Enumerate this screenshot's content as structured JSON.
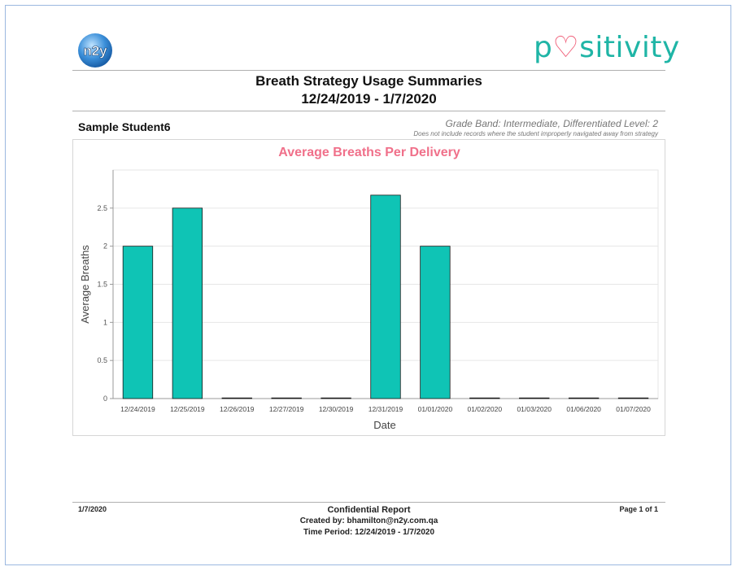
{
  "header": {
    "n2y_logo_text": "n2y",
    "brand_logo": {
      "pre": "p",
      "heart_glyph": "♡",
      "post": "sitivity"
    },
    "title": "Breath Strategy Usage Summaries",
    "date_range": "12/24/2019 - 1/7/2020"
  },
  "student": {
    "name": "Sample Student6",
    "grade_info": "Grade Band: Intermediate, Differentiated Level: 2",
    "note": "Does not include records where the student improperly navigated away from strategy"
  },
  "chart_data": {
    "type": "bar",
    "title": "Average Breaths Per Delivery",
    "xlabel": "Date",
    "ylabel": "Average Breaths",
    "categories": [
      "12/24/2019",
      "12/25/2019",
      "12/26/2019",
      "12/27/2019",
      "12/30/2019",
      "12/31/2019",
      "01/01/2020",
      "01/02/2020",
      "01/03/2020",
      "01/06/2020",
      "01/07/2020"
    ],
    "values": [
      2,
      2.5,
      0,
      0,
      0,
      2.67,
      2,
      0,
      0,
      0,
      0
    ],
    "ylim": [
      0,
      3
    ],
    "yticks": [
      "0",
      "0.5",
      "1",
      "1.5",
      "2",
      "2.5"
    ],
    "grid": true,
    "colors": {
      "bar": "#0fc4b5",
      "bar_stroke": "#1a1a1a",
      "title": "#f0708a"
    }
  },
  "footer": {
    "date": "1/7/2020",
    "page": "Page 1 of 1",
    "confidential": "Confidential Report",
    "created_by": "Created by: bhamilton@n2y.com.qa",
    "time_period": "Time Period: 12/24/2019 - 1/7/2020"
  }
}
